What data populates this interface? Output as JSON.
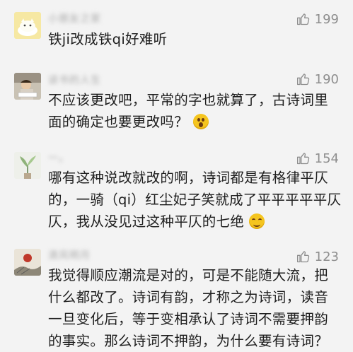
{
  "comments": [
    {
      "username": "小朋友之家",
      "likes": "199",
      "text": "铁ji改成铁qi好难听",
      "avatar_icon": "cartoon-cat-avatar-icon"
    },
    {
      "username": "读书的人生",
      "likes": "190",
      "text": "不应该更改吧，平常的字也就算了，古诗词里面的确定也要更改吗？",
      "emoji": "shocked-face-emoji",
      "avatar_icon": "child-reading-avatar-icon"
    },
    {
      "username": "一。",
      "likes": "154",
      "text": "哪有这种说改就改的啊，诗词都是有格律平仄的，一骑（qi）红尘妃子笑就成了平平平平平仄仄，我从没见过这种平仄的七绝",
      "emoji": "upside-down-face-emoji",
      "avatar_icon": "plant-avatar-icon"
    },
    {
      "username": "清风明月",
      "likes": "123",
      "text": "我觉得顺应潮流是对的，可是不能随大流，把什么都改了。诗词有韵，才称之为诗词，读音一旦变化后，等于变相承认了诗词不需要押韵的事实。那么诗词不押韵，为什么要有诗词？",
      "avatar_icon": "landscape-painting-avatar-icon"
    }
  ],
  "colors": {
    "background": "#f3f3f3",
    "text": "#1e1e1e",
    "like_gray": "#8e8e8e"
  }
}
